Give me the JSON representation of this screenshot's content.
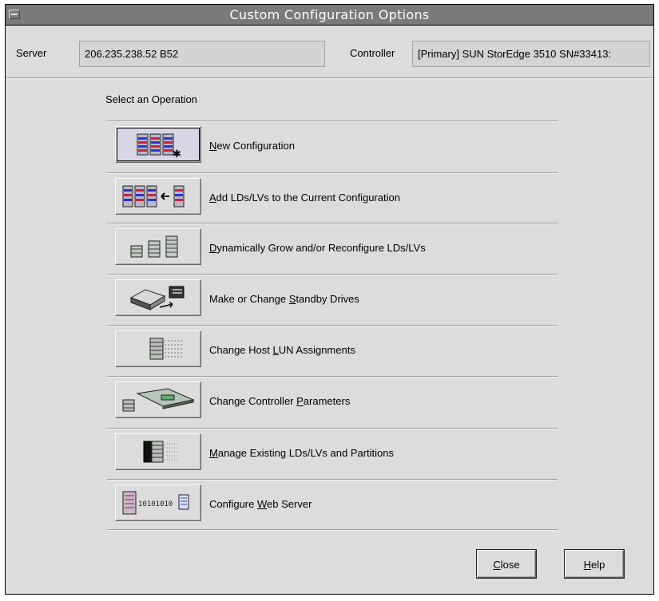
{
  "window": {
    "title": "Custom Configuration Options"
  },
  "server": {
    "label": "Server",
    "value": "206.235.238.52 B52"
  },
  "controller": {
    "label": "Controller",
    "value": "[Primary] SUN StorEdge 3510 SN#33413:"
  },
  "prompt": "Select an Operation",
  "operations": [
    {
      "pre": "",
      "mnemonic": "N",
      "post": "ew Configuration",
      "icon": "new-configuration-icon"
    },
    {
      "pre": "",
      "mnemonic": "A",
      "post": "dd LDs/LVs to the Current Configuration",
      "icon": "add-ld-icon"
    },
    {
      "pre": "",
      "mnemonic": "D",
      "post": "ynamically Grow and/or Reconfigure LDs/LVs",
      "icon": "grow-ld-icon"
    },
    {
      "pre": "Make or Change ",
      "mnemonic": "S",
      "post": "tandby Drives",
      "icon": "standby-drive-icon"
    },
    {
      "pre": "Change Host ",
      "mnemonic": "L",
      "post": "UN Assignments",
      "icon": "lun-assign-icon"
    },
    {
      "pre": "Change Controller ",
      "mnemonic": "P",
      "post": "arameters",
      "icon": "controller-params-icon"
    },
    {
      "pre": "",
      "mnemonic": "M",
      "post": "anage Existing LDs/LVs and Partitions",
      "icon": "manage-ld-icon"
    },
    {
      "pre": "Configure ",
      "mnemonic": "W",
      "post": "eb Server",
      "icon": "web-server-icon"
    }
  ],
  "buttons": {
    "close": {
      "mnemonic": "C",
      "rest": "lose"
    },
    "help": {
      "mnemonic": "H",
      "rest": "elp"
    }
  },
  "colors": {
    "title_bar": "#7a7a7a",
    "window_bg": "#dcdcdc",
    "field_bg": "#d4d4d4"
  }
}
